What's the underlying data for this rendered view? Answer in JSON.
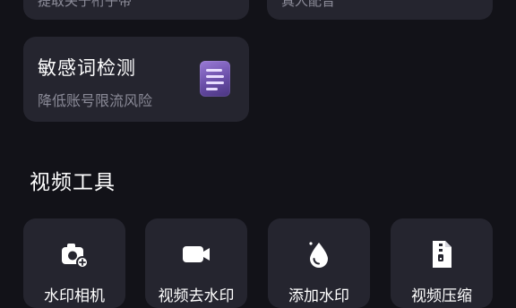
{
  "top_cards": [
    {
      "label": "提取关于桁子带"
    },
    {
      "label": "真人配音"
    }
  ],
  "sensitive_card": {
    "title": "敏感词检测",
    "subtitle": "降低账号限流风险",
    "icon": "document-list-icon"
  },
  "video_tools": {
    "section_title": "视频工具",
    "items": [
      {
        "label": "水印相机",
        "icon": "camera-plus-icon"
      },
      {
        "label": "视频去水印",
        "icon": "video-camera-icon"
      },
      {
        "label": "添加水印",
        "icon": "water-drop-icon"
      },
      {
        "label": "视频压缩",
        "icon": "zip-file-icon"
      }
    ]
  },
  "colors": {
    "background": "#121218",
    "card": "#25252f",
    "accent": "#8b6cd0"
  }
}
